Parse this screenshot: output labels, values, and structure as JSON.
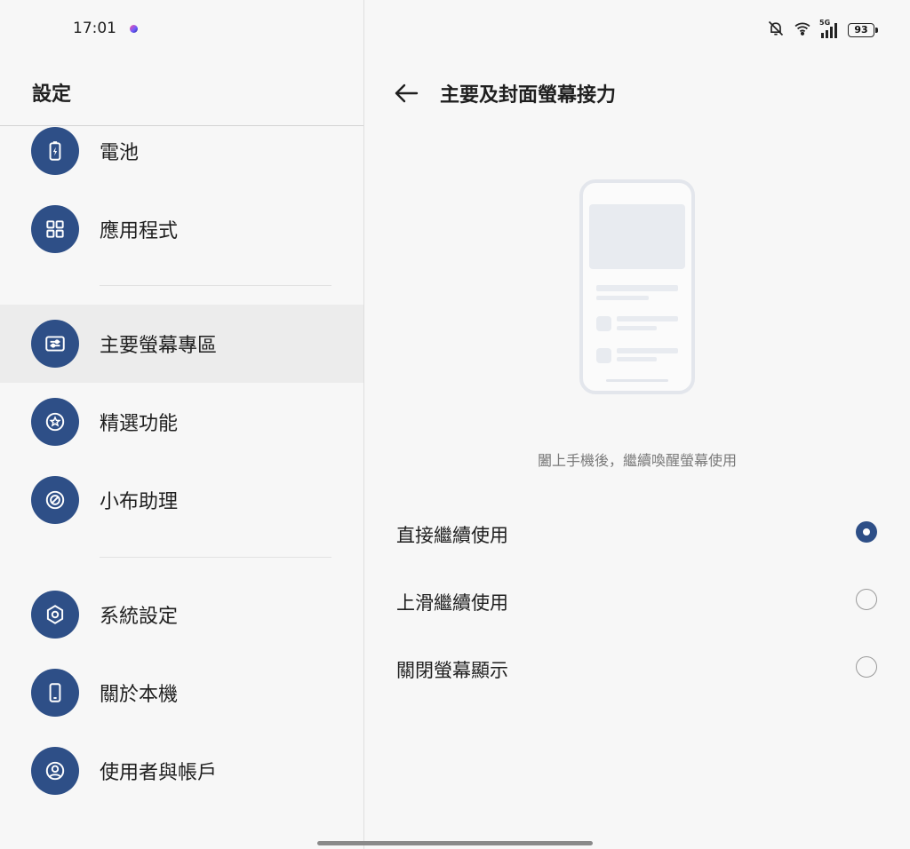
{
  "status_bar": {
    "time": "17:01",
    "network": "5G",
    "battery": "93",
    "icons": [
      "mute-icon",
      "wifi-icon",
      "signal-icon",
      "battery-icon"
    ]
  },
  "sidebar": {
    "title": "設定",
    "items": [
      {
        "label": "電池",
        "icon": "battery-icon"
      },
      {
        "label": "應用程式",
        "icon": "apps-icon"
      },
      {
        "label": "主要螢幕專區",
        "icon": "sliders-icon",
        "selected": true
      },
      {
        "label": "精選功能",
        "icon": "star-badge-icon"
      },
      {
        "label": "小布助理",
        "icon": "assistant-icon"
      },
      {
        "label": "系統設定",
        "icon": "hexagon-settings-icon"
      },
      {
        "label": "關於本機",
        "icon": "phone-icon"
      },
      {
        "label": "使用者與帳戶",
        "icon": "user-icon"
      }
    ]
  },
  "detail": {
    "title": "主要及封面螢幕接力",
    "caption": "闔上手機後，繼續喚醒螢幕使用",
    "options": [
      {
        "label": "直接繼續使用",
        "checked": true
      },
      {
        "label": "上滑繼續使用",
        "checked": false
      },
      {
        "label": "關閉螢幕顯示",
        "checked": false
      }
    ]
  },
  "colors": {
    "accent": "#2e4f87",
    "background": "#f7f7f7",
    "selected_row": "#ececec"
  }
}
